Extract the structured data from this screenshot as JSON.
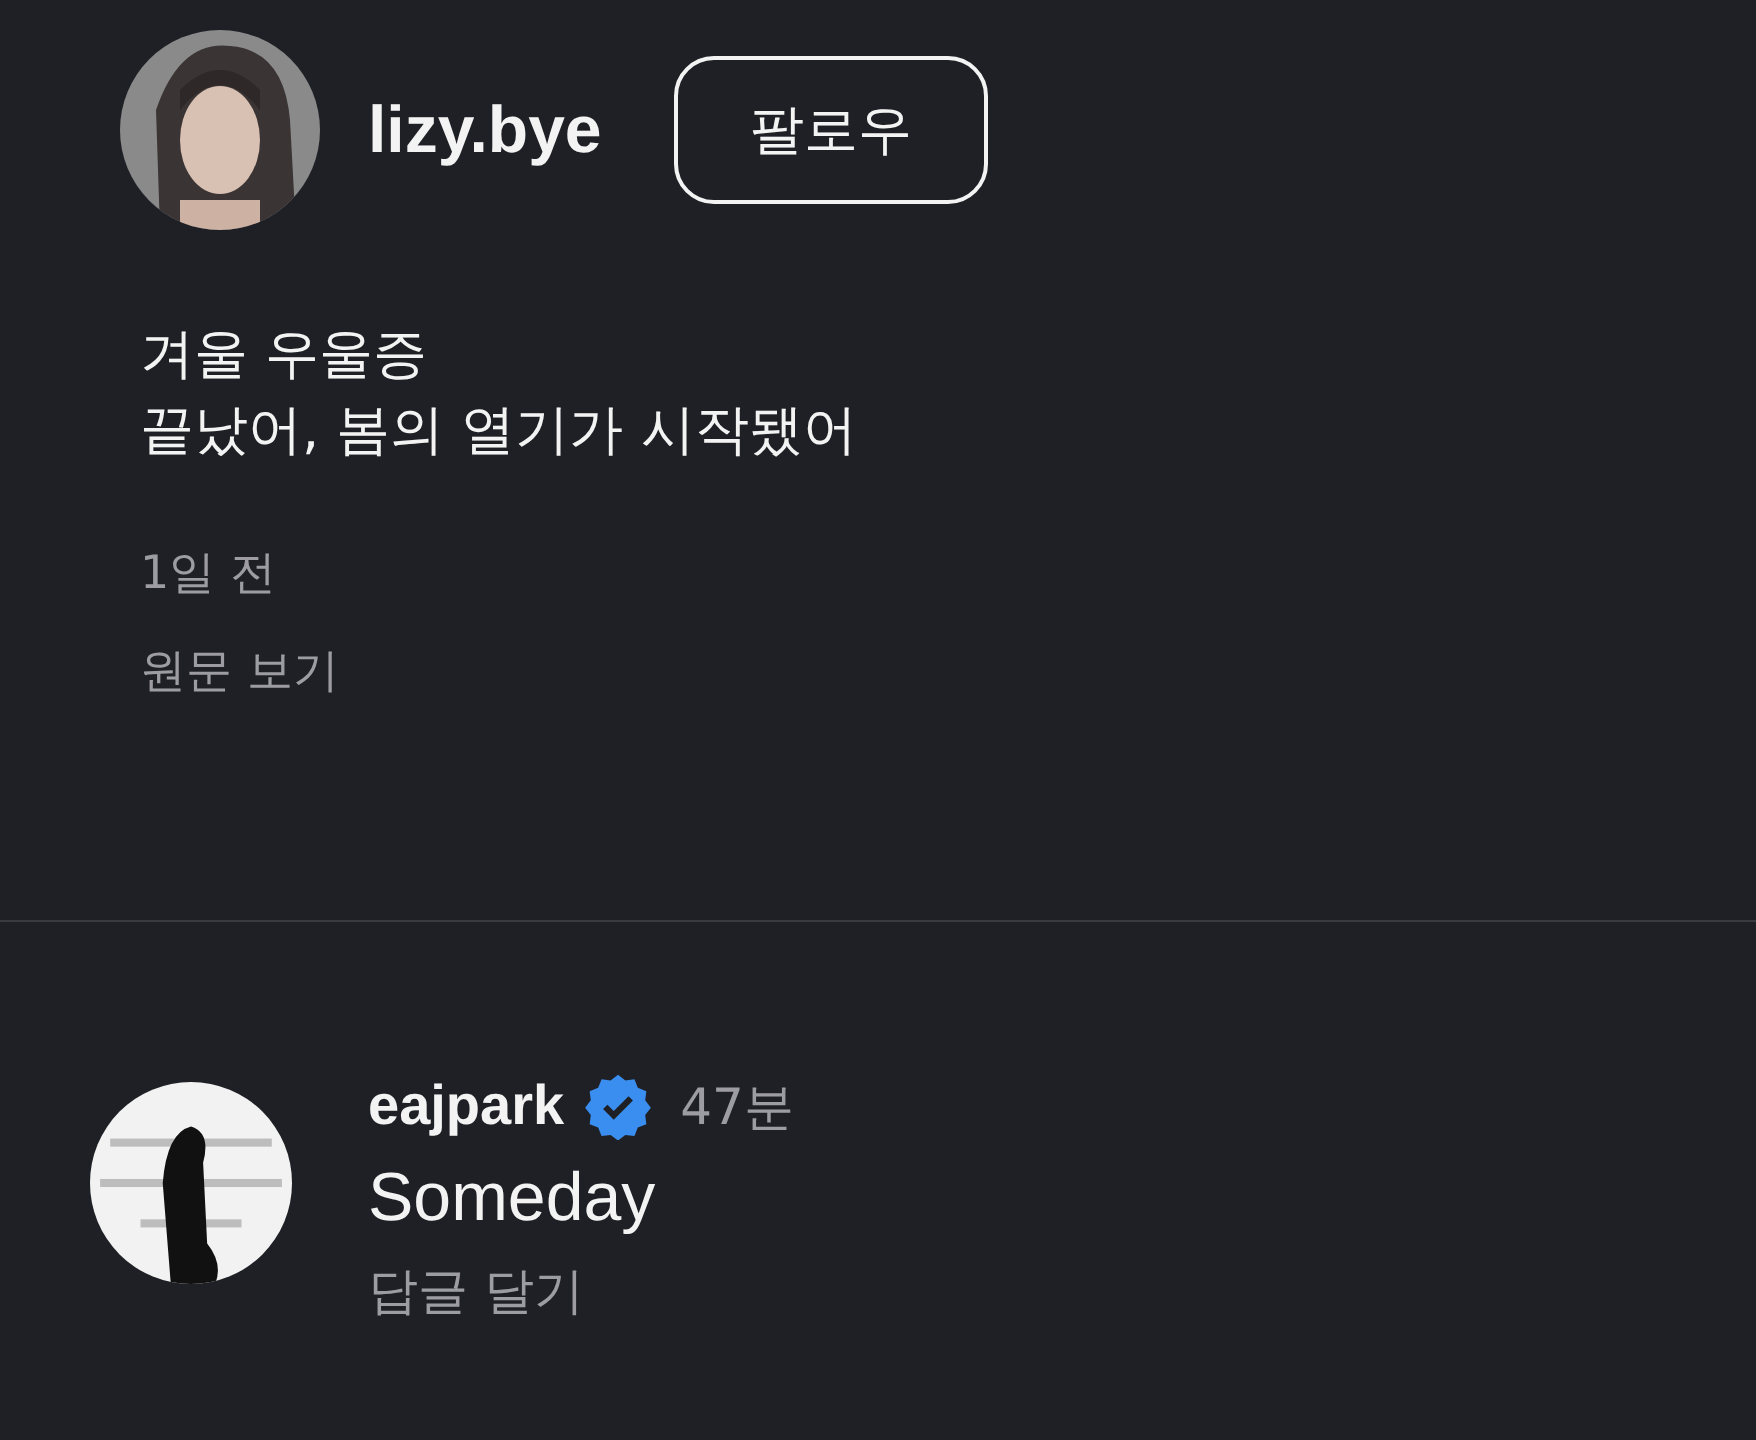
{
  "post": {
    "username": "lizy.bye",
    "follow_button": "팔로우",
    "lines": [
      "겨울 우울증",
      "끝났어, 봄의 열기가 시작됐어"
    ],
    "time": "1일 전",
    "translate_link": "원문 보기"
  },
  "comments": [
    {
      "username": "eajpark",
      "verified": true,
      "time": "47분",
      "text": "Someday",
      "reply_link": "답글 달기"
    }
  ]
}
